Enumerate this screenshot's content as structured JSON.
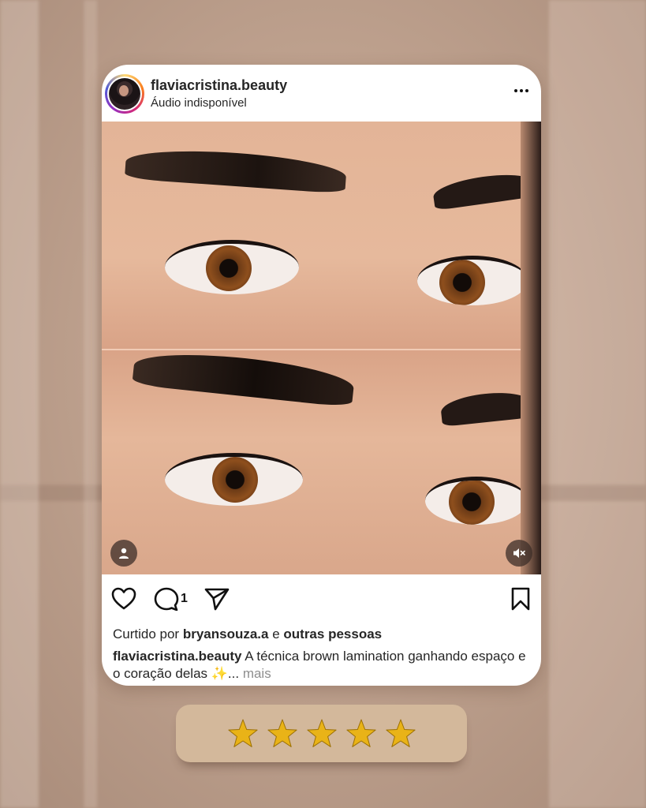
{
  "post": {
    "username": "flaviacristina.beauty",
    "audio_label": "Áudio indisponível",
    "comment_count": "1",
    "likes_prefix": "Curtido por ",
    "likes_user": "bryansouza.a",
    "likes_mid": " e ",
    "likes_suffix": "outras pessoas",
    "caption_user": "flaviacristina.beauty",
    "caption_text": " A técnica brown lamination ganhando espaço e o coração delas ✨...",
    "caption_more": " mais"
  },
  "icons": {
    "more": "more-options-icon",
    "tag": "user-tag-icon",
    "mute": "muted-speaker-icon",
    "like": "heart-icon",
    "comment": "comment-bubble-icon",
    "share": "send-icon",
    "save": "bookmark-icon",
    "rating": "star-icon"
  },
  "rating": {
    "stars": 5,
    "max": 5
  },
  "colors": {
    "card": "#ffffff",
    "rating_bar": "#d3b89b",
    "star_gold": "#e9b317",
    "text": "#262626",
    "muted_text": "#8e8e8e"
  }
}
